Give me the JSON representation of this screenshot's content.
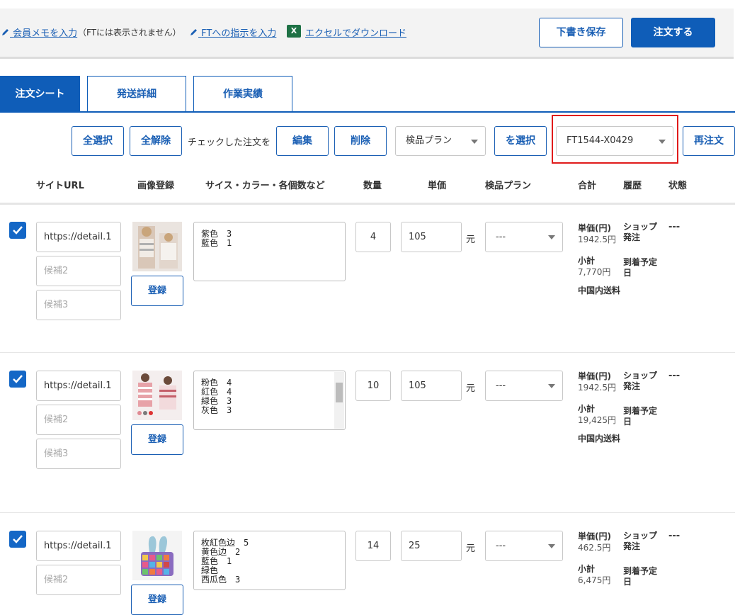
{
  "toolbar": {
    "member_memo": "会員メモを入力",
    "ft_note": "（FTには表示されません）",
    "ft_instruction": "FTへの指示を入力",
    "excel_icon": "X",
    "excel_download": "エクセルでダウンロード",
    "draft_save": "下書き保存",
    "order": "注文する"
  },
  "tabs": [
    {
      "label": "注文シート",
      "active": true
    },
    {
      "label": "発送詳細",
      "active": false
    },
    {
      "label": "作業実績",
      "active": false
    }
  ],
  "actions": {
    "select_all": "全選択",
    "deselect_all": "全解除",
    "checked_label": "チェックした注文を",
    "edit": "編集",
    "delete": "削除",
    "inspection_plan": "検品プラン",
    "select_btn": "を選択",
    "order_id": "FT1544-X0429",
    "reorder": "再注文"
  },
  "columns": [
    "サイトURL",
    "画像登録",
    "サイス・カラー・各個数など",
    "数量",
    "単価",
    "検品プラン",
    "合計",
    "履歴",
    "状態"
  ],
  "rows": [
    {
      "url": "https://detail.1",
      "cand2": "候補2",
      "cand3": "候補3",
      "register": "登録",
      "details": "紫色　3\n藍色　1",
      "qty": "4",
      "price": "105",
      "currency": "元",
      "plan": "---",
      "unit_label": "単価(円)",
      "unit_value": "1942.5円",
      "subtotal_label": "小計",
      "subtotal_value": "7,770円",
      "shipping_label": "中国内送料",
      "hist1": "ショップ発注",
      "hist2": "到着予定日",
      "status": "---"
    },
    {
      "url": "https://detail.1",
      "cand2": "候補2",
      "cand3": "候補3",
      "register": "登録",
      "details": "粉色　4\n紅色　4\n緑色　3\n灰色　3",
      "qty": "10",
      "price": "105",
      "currency": "元",
      "plan": "---",
      "unit_label": "単価(円)",
      "unit_value": "1942.5円",
      "subtotal_label": "小計",
      "subtotal_value": "19,425円",
      "shipping_label": "中国内送料",
      "hist1": "ショップ発注",
      "hist2": "到着予定日",
      "status": "---"
    },
    {
      "url": "https://detail.1",
      "cand2": "候補2",
      "register": "登録",
      "details": "枚紅色边　5\n黄色边　2\n藍色　1\n緑色\n西瓜色　3",
      "qty": "14",
      "price": "25",
      "currency": "元",
      "plan": "---",
      "unit_label": "単価(円)",
      "unit_value": "462.5円",
      "subtotal_label": "小計",
      "subtotal_value": "6,475円",
      "hist1": "ショップ発注",
      "hist2": "到着予定日",
      "status": "---"
    }
  ],
  "colors": {
    "accent": "#0f5db8",
    "highlight": "#e01b1b",
    "checkbox": "#1467c6"
  }
}
